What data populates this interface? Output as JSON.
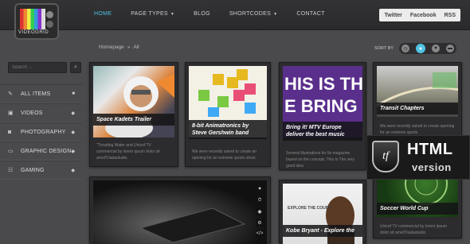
{
  "header": {
    "logo_text": "VIDEOGRID",
    "nav": [
      {
        "label": "HOME",
        "active": true,
        "caret": false
      },
      {
        "label": "PAGE TYPES",
        "active": false,
        "caret": true
      },
      {
        "label": "BLOG",
        "active": false,
        "caret": false
      },
      {
        "label": "SHORTCODES",
        "active": false,
        "caret": true
      },
      {
        "label": "CONTACT",
        "active": false,
        "caret": false
      }
    ],
    "social": [
      "Twitter",
      "Facebook",
      "RSS"
    ]
  },
  "breadcrumb": {
    "home": "Homepage",
    "separator": "»",
    "current": "All"
  },
  "sort": {
    "label": "SORT BY"
  },
  "search": {
    "placeholder": "Search ..."
  },
  "sidebar": {
    "items": [
      {
        "label": "ALL ITEMS",
        "icon": "tag-icon",
        "glyph": "✎",
        "mark": "■"
      },
      {
        "label": "VIDEOS",
        "icon": "video-icon",
        "glyph": "▣",
        "mark": "◆"
      },
      {
        "label": "PHOTOGRAPHY",
        "icon": "camera-icon",
        "glyph": "◙",
        "mark": "◆"
      },
      {
        "label": "GRAPHIC DESIGN",
        "icon": "monitor-icon",
        "glyph": "▭",
        "mark": "◆"
      },
      {
        "label": "GAMING",
        "icon": "gamepad-icon",
        "glyph": "☷",
        "mark": "◆"
      }
    ]
  },
  "cards": [
    {
      "title": "Space Kadets Trailer",
      "desc": "\"Treading Water and Unicef TV commercial by lorem ipsum dolor sit ametTriadastudio."
    },
    {
      "title": "8-bit Animatronics by Steve Gershwin band",
      "desc": "We were recently asked to create an opening for an extreme sports show"
    },
    {
      "title": "Bring it! MTV Europe deliver the best music",
      "desc": "Several illustrations for Ile magazine based on the concept, This Is The very good idea"
    },
    {
      "title": "Transit Chapters",
      "desc": "We were recently asked to create opening for an extreme sports"
    },
    {
      "title": "",
      "desc": ""
    },
    {
      "title": "Kobe Bryant - Explore the",
      "desc": "",
      "overlay": "EXPLORE THE COURT"
    },
    {
      "title": "Soccer World Cup",
      "desc": "Unicef TV commercial by lorem ipsum dolor sit ametTriadastudio"
    }
  ],
  "poster_text": {
    "line1": "HIS IS THE",
    "line2": "E BRING"
  },
  "video_icons": [
    "♥",
    "⏱",
    "◉",
    "⚙",
    "</>"
  ],
  "badge": {
    "logo": "tf",
    "line1": "HTML",
    "line2": "version"
  },
  "colors": {
    "accent": "#4fc3e4",
    "background": "#4a4a4c",
    "topbar": "#2f2f31"
  }
}
